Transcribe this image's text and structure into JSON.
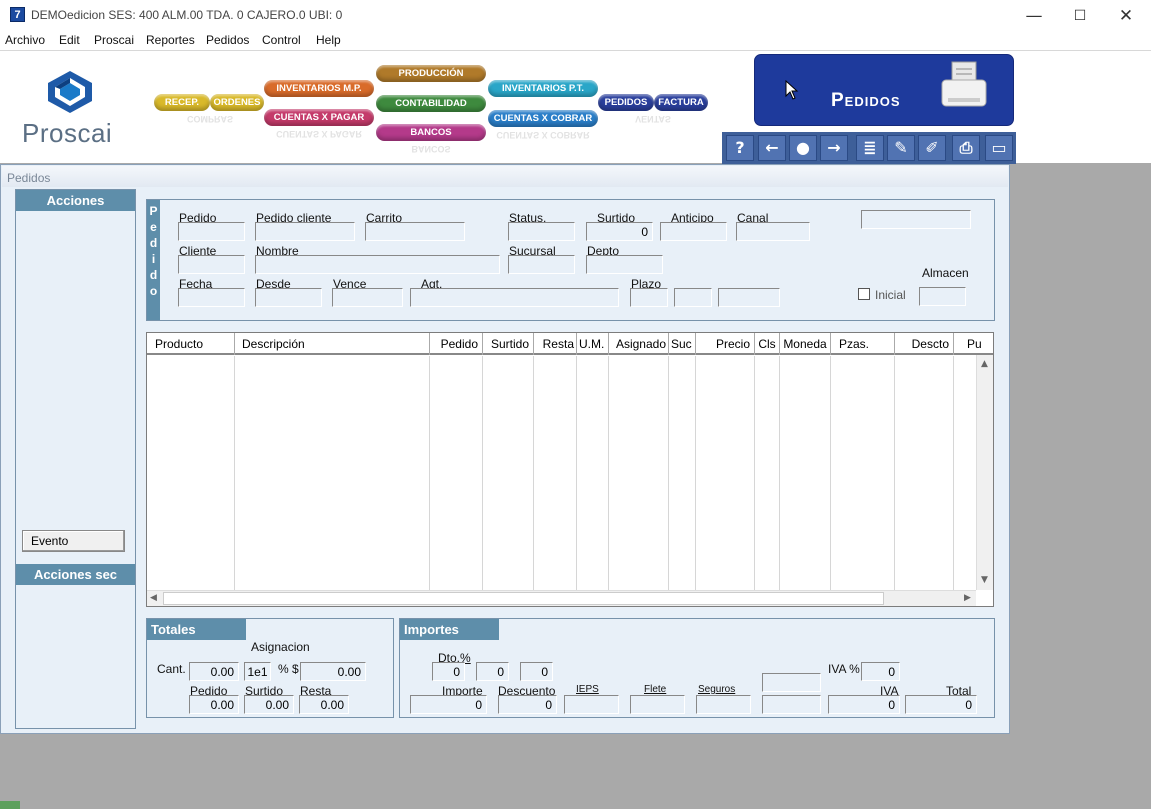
{
  "titlebar": {
    "app_icon": "7",
    "title": "DEMOedicion   SES: 400   ALM.00   TDA. 0   CAJERO.0   UBI: 0",
    "min": "—",
    "max": "☐",
    "close": "✕"
  },
  "menu": [
    "Archivo",
    "Edit",
    "Proscai",
    "Reportes",
    "Pedidos",
    "Control",
    "Help"
  ],
  "logo": {
    "text": "Proscai"
  },
  "nav_buttons": {
    "recep": "RECEP.",
    "ordenes": "ORDENES",
    "inventarios_mp": "INVENTARIOS M.P.",
    "cuentas_pagar": "CUENTAS X PAGAR",
    "produccion": "PRODUCCIÓN",
    "contabilidad": "CONTABILIDAD",
    "bancos": "BANCOS",
    "inventarios_pt": "INVENTARIOS P.T.",
    "cuentas_cobrar": "CUENTAS X COBRAR",
    "pedidos": "PEDIDOS",
    "factura": "FACTURA",
    "refl_compras": "COMPRAS",
    "refl_cuentas_pagar": "CUENTAS X PAGAR",
    "refl_bancos": "BANCOS",
    "refl_cuentas_cobrar": "CUENTAS X COBRAR",
    "refl_ventas": "VENTAS"
  },
  "banner": {
    "title": "Pedidos"
  },
  "tool_icons": [
    "help-icon",
    "arrow-left-icon",
    "search-icon",
    "arrow-right-icon",
    "list-icon",
    "edit-doc-icon",
    "pencil-icon",
    "printer-icon",
    "window-icon"
  ],
  "tool_glyphs": {
    "help": "?",
    "left": "←",
    "search": "●",
    "right": "→",
    "list": "≣",
    "doc": "✎",
    "pencil": "✐",
    "print": "⎙",
    "window": "▭"
  },
  "window": {
    "caption": "Pedidos"
  },
  "left_panel": {
    "acciones": "Acciones",
    "evento": "Evento",
    "acciones_sec": "Acciones sec"
  },
  "pedido_section": {
    "side_letters": [
      "P",
      "e",
      "d",
      "i",
      "d",
      "o"
    ],
    "labels": {
      "pedido": "Pedido",
      "pedido_cliente": "Pedido cliente",
      "carrito": "Carrito",
      "status": "Status.",
      "surtido": "Surtido",
      "anticipo": "Anticipo",
      "canal": "Canal",
      "cliente": "Cliente",
      "nombre": "Nombre",
      "sucursal": "Sucursal",
      "depto": "Depto",
      "fecha": "Fecha",
      "desde": "Desde",
      "vence": "Vence",
      "agt": "Agt.",
      "plazo": "Plazo",
      "almacen": "Almacen",
      "inicial": "Inicial"
    },
    "values": {
      "surtido": "0"
    }
  },
  "grid": {
    "columns": [
      "Producto",
      "Descripción",
      "Pedido",
      "Surtido",
      "Resta",
      "U.M.",
      "Asignado",
      "Suc",
      "Precio",
      "Cls",
      "Moneda",
      "Pzas.",
      "Descto",
      "Pu"
    ],
    "scroll_up": "▲",
    "scroll_down": "▼",
    "scroll_left": "◀",
    "scroll_right": "▶"
  },
  "totales": {
    "title": "Totales",
    "asignacion": "Asignacion",
    "cant_label": "Cant.",
    "cant_value": "0.00",
    "tei": "1e1",
    "pct_label": "% $",
    "pct_value": "0.00",
    "pedido_label": "Pedido",
    "surtido_label": "Surtido",
    "resta_label": "Resta",
    "pedido_value": "0.00",
    "surtido_value": "0.00",
    "resta_value": "0.00"
  },
  "importes": {
    "title": "Importes",
    "dto_label": "Dto.%",
    "dto1": "0",
    "dto2": "0",
    "dto3": "0",
    "iva_pct_label": "IVA %",
    "iva_pct_value": "0",
    "importe_label": "Importe",
    "descuento_label": "Descuento",
    "ieps_label": "IEPS",
    "flete_label": "Flete",
    "seguros_label": "Seguros",
    "iva_label": "IVA",
    "total_label": "Total",
    "importe_value": "0",
    "descuento_value": "0",
    "iva_value": "0",
    "total_value": "0"
  }
}
